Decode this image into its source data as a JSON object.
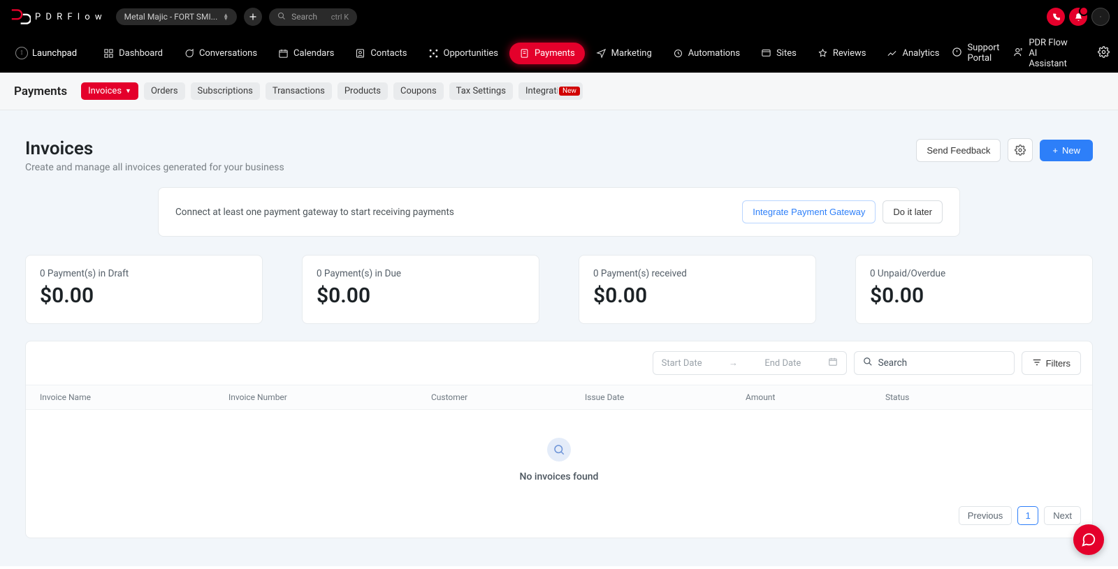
{
  "brand": {
    "name": "P D R  F l o w"
  },
  "topbar": {
    "account": "Metal Majic - FORT SMI...",
    "search_placeholder": "Search",
    "search_shortcut": "ctrl K"
  },
  "mainnav": {
    "launchpad": "Launchpad",
    "items": [
      {
        "label": "Dashboard"
      },
      {
        "label": "Conversations"
      },
      {
        "label": "Calendars"
      },
      {
        "label": "Contacts"
      },
      {
        "label": "Opportunities"
      },
      {
        "label": "Payments"
      },
      {
        "label": "Marketing"
      },
      {
        "label": "Automations"
      },
      {
        "label": "Sites"
      },
      {
        "label": "Reviews"
      },
      {
        "label": "Analytics"
      }
    ],
    "support": "Support Portal",
    "ai": "PDR Flow AI Assistant"
  },
  "subbar": {
    "title": "Payments",
    "tabs": [
      {
        "label": "Invoices",
        "active": true,
        "hasCaret": true
      },
      {
        "label": "Orders"
      },
      {
        "label": "Subscriptions"
      },
      {
        "label": "Transactions"
      },
      {
        "label": "Products"
      },
      {
        "label": "Coupons"
      },
      {
        "label": "Tax Settings"
      },
      {
        "label": "Integrations",
        "badge": "New"
      }
    ]
  },
  "page": {
    "title": "Invoices",
    "subtitle": "Create and manage all invoices generated for your business",
    "feedback": "Send Feedback",
    "new": "New"
  },
  "notice": {
    "text": "Connect at least one payment gateway to start receiving payments",
    "primary": "Integrate Payment Gateway",
    "secondary": "Do it later"
  },
  "stats": [
    {
      "label": "0 Payment(s) in Draft",
      "value": "$0.00"
    },
    {
      "label": "0 Payment(s) in Due",
      "value": "$0.00"
    },
    {
      "label": "0 Payment(s) received",
      "value": "$0.00"
    },
    {
      "label": "0 Unpaid/Overdue",
      "value": "$0.00"
    }
  ],
  "toolbar": {
    "start_date": "Start Date",
    "end_date": "End Date",
    "search_placeholder": "Search",
    "filters": "Filters"
  },
  "table": {
    "headers": [
      "Invoice Name",
      "Invoice Number",
      "Customer",
      "Issue Date",
      "Amount",
      "Status"
    ],
    "empty": "No invoices found"
  },
  "pager": {
    "prev": "Previous",
    "page": "1",
    "next": "Next"
  }
}
